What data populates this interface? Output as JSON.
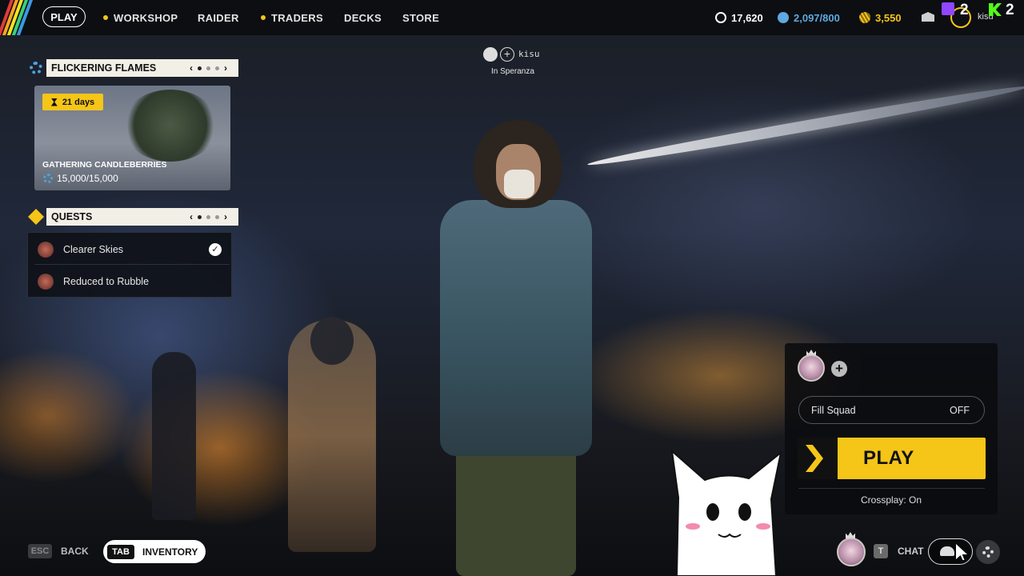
{
  "topnav": {
    "items": [
      {
        "label": "PLAY",
        "active": true,
        "dot": false
      },
      {
        "label": "WORKSHOP",
        "dot": true
      },
      {
        "label": "RAIDER",
        "dot": false
      },
      {
        "label": "TRADERS",
        "dot": true
      },
      {
        "label": "DECKS",
        "dot": false
      },
      {
        "label": "STORE",
        "dot": false
      }
    ],
    "currencies": [
      {
        "icon": "raider-token-icon",
        "value": "17,620"
      },
      {
        "icon": "credits-icon",
        "value": "2,097/800"
      },
      {
        "icon": "coins-icon",
        "value": "3,550"
      }
    ],
    "username": "kisu",
    "twitch_count": "2",
    "kick_count": "2"
  },
  "party_header": {
    "name": "kisu",
    "location": "In Speranza"
  },
  "event": {
    "title": "FLICKERING FLAMES",
    "badge": "21 days",
    "name": "GATHERING CANDLEBERRIES",
    "progress": "15,000/15,000",
    "page": "2 of 3"
  },
  "quests": {
    "title": "QUESTS",
    "items": [
      {
        "label": "Clearer Skies",
        "completed": true
      },
      {
        "label": "Reduced to Rubble",
        "completed": false
      }
    ]
  },
  "squad": {
    "fill_squad_label": "Fill Squad",
    "fill_squad_value": "OFF",
    "play_label": "PLAY",
    "crossplay": "Crossplay: On"
  },
  "bottom": {
    "esc_key": "ESC",
    "back_label": "BACK",
    "tab_key": "TAB",
    "inventory_label": "INVENTORY",
    "chat_key": "T",
    "chat_label": "CHAT"
  },
  "colors": {
    "accent": "#f5c518",
    "panel_header_bg": "#f1efe6",
    "credits": "#5fa8e0"
  }
}
